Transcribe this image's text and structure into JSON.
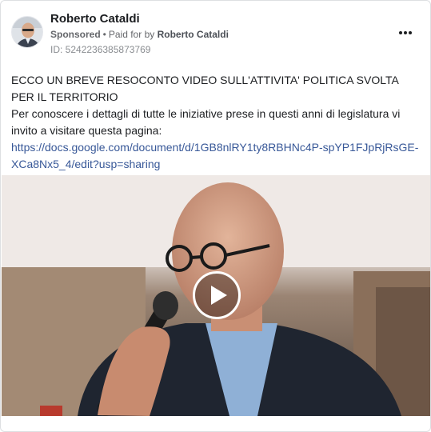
{
  "post": {
    "author": "Roberto Cataldi",
    "sponsored_label": "Sponsored",
    "paid_for_label": "Paid for by",
    "payer": "Roberto Cataldi",
    "ad_id": "ID: 5242236385873769",
    "more_icon": "more-horizontal-icon",
    "text_line1": "ECCO UN BREVE RESOCONTO VIDEO SULL'ATTIVITA' POLITICA SVOLTA PER IL TERRITORIO",
    "text_line2": "Per conoscere i dettagli di tutte le iniziative prese in questi anni di legislatura vi invito a visitare questa pagina:",
    "link": "https://docs.google.com/document/d/1GB8nlRY1ty8RBHNc4P-spYP1FJpRjRsGE-XCa8Nx5_4/edit?usp=sharing"
  },
  "video": {
    "play_icon": "play-icon"
  },
  "colors": {
    "link": "#385898",
    "meta": "#65676b",
    "border": "#dddfe2"
  }
}
